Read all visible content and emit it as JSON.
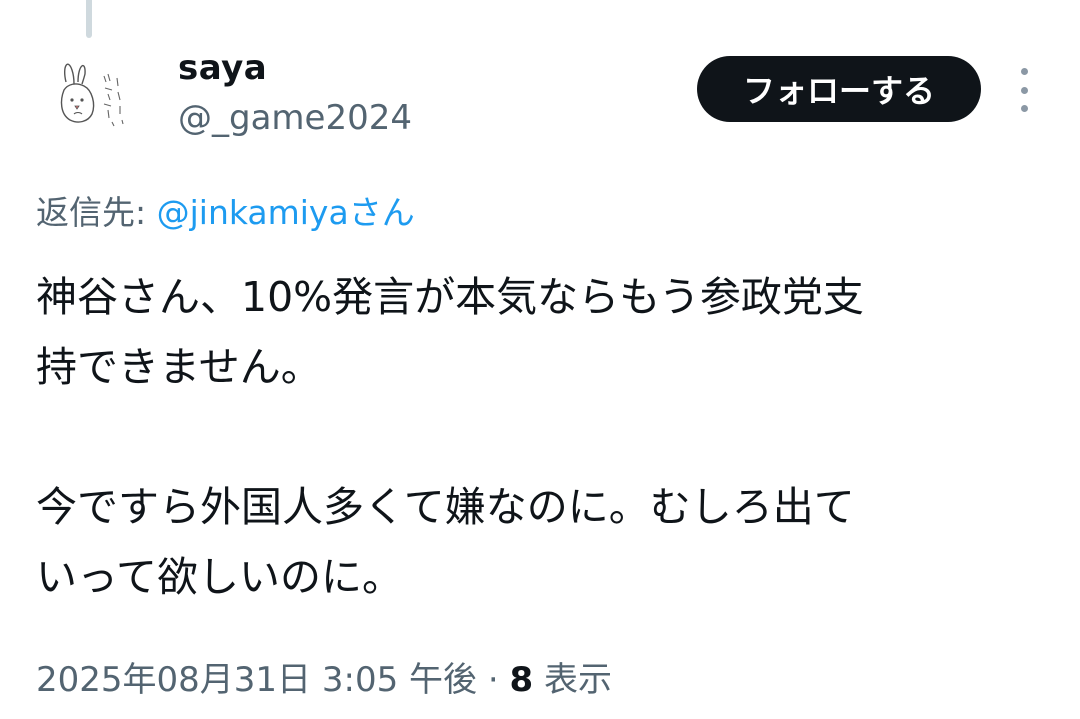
{
  "user": {
    "display_name": "saya",
    "handle": "@_game2024"
  },
  "follow_button_label": "フォローする",
  "more_icon": "more-vertical-icon",
  "reply_to": {
    "prefix": "返信先: ",
    "mention": "@jinkamiya",
    "suffix": "さん"
  },
  "tweet": {
    "paragraph_1_line_1": "神谷さん、10%発言が本気ならもう参政党支",
    "paragraph_1_line_2": "持できません。",
    "paragraph_2_line_1": "今ですら外国人多くて嫌なのに。むしろ出て",
    "paragraph_2_line_2": "いって欲しいのに。"
  },
  "meta": {
    "timestamp": "2025年08月31日 3:05 午後",
    "separator": " · ",
    "views_count": "8",
    "views_label": " 表示"
  },
  "colors": {
    "text_primary": "#0f1419",
    "text_secondary": "#536471",
    "link": "#1d9bf0",
    "follow_button_bg": "#0f1419",
    "thread_line": "#cfd9de"
  }
}
